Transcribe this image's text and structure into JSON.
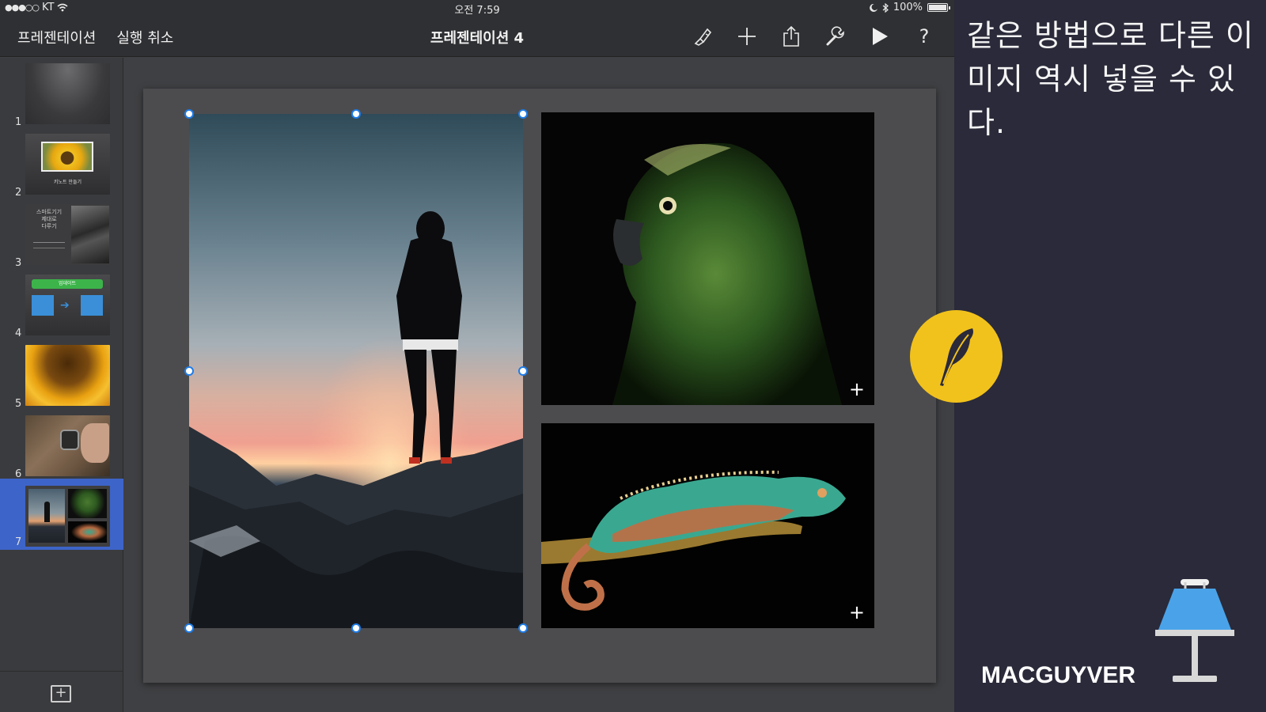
{
  "status_bar": {
    "carrier": "KT",
    "time": "오전 7:59",
    "battery": "100%"
  },
  "toolbar": {
    "presentations_label": "프레젠테이션",
    "undo_label": "실행 취소",
    "document_title": "프레젠테이션 4",
    "help_label": "?"
  },
  "navigator": {
    "slides": [
      {
        "number": "1"
      },
      {
        "number": "2",
        "caption": "키노트 만들기"
      },
      {
        "number": "3",
        "title": "스마트기기\n제대로\n다루기"
      },
      {
        "number": "4",
        "banner": "업데이트"
      },
      {
        "number": "5"
      },
      {
        "number": "6"
      },
      {
        "number": "7"
      }
    ],
    "selected_slide": "7"
  },
  "canvas": {
    "images": [
      {
        "name": "hiker-at-sunset"
      },
      {
        "name": "green-parrot"
      },
      {
        "name": "chameleon-on-branch"
      }
    ],
    "plus_symbol": "+"
  },
  "panel": {
    "caption": "같은 방법으로 다른 이미지 역시 넣을 수 있다.",
    "brand": "MACGUYVER"
  },
  "colors": {
    "selection_blue": "#3d64c8",
    "handle_blue": "#1e7ce8",
    "badge_yellow": "#f2c21c",
    "keynote_blue": "#4aa3e8"
  }
}
